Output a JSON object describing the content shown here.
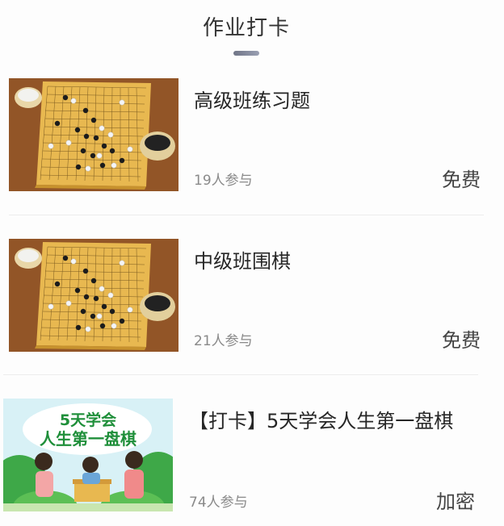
{
  "header": {
    "title": "作业打卡"
  },
  "courses": [
    {
      "title": "高级班练习题",
      "participants": "19人参与",
      "price": "免费"
    },
    {
      "title": "中级班围棋",
      "participants": "21人参与",
      "price": "免费"
    },
    {
      "title": "【打卡】5天学会人生第一盘棋",
      "participants": "74人参与",
      "price": "加密",
      "banner_line1": "5天学会",
      "banner_line2": "人生第一盘棋"
    }
  ],
  "colors": {
    "board": "#e8b850",
    "wood_bg": "#8a4f24",
    "banner_green": "#3ea848",
    "banner_sky": "#d8f1f6"
  }
}
